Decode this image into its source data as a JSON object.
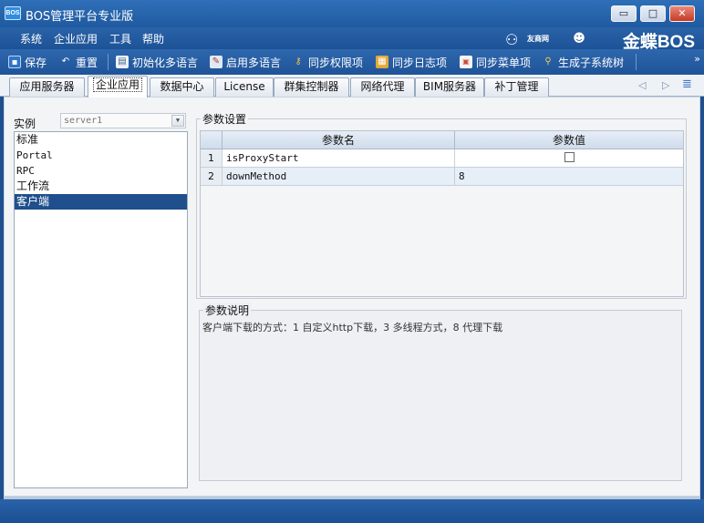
{
  "window": {
    "app_icon_text": "BOS",
    "title": "BOS管理平台专业版",
    "controls": {
      "minimize": "▭",
      "maximize": "□",
      "close": "✕"
    }
  },
  "menu": [
    "系统",
    "企业应用",
    "工具",
    "帮助"
  ],
  "brand": {
    "yy_text": "友商网",
    "kd_text": "金蝶BOS"
  },
  "toolbar": [
    {
      "label": "保存",
      "icon": "save-icon",
      "color": "#2f74c9"
    },
    {
      "label": "重置",
      "icon": "reset-icon",
      "color": "#6aa0de"
    },
    {
      "label": "初始化多语言",
      "icon": "document-icon",
      "color": "#e9eef6"
    },
    {
      "label": "启用多语言",
      "icon": "edit-icon",
      "color": "#7ba7d8"
    },
    {
      "label": "同步权限项",
      "icon": "key-icon",
      "color": "#e8b640"
    },
    {
      "label": "同步日志项",
      "icon": "log-icon",
      "color": "#d9a23a"
    },
    {
      "label": "同步菜单项",
      "icon": "menu-icon",
      "color": "#c94b3b"
    },
    {
      "label": "生成子系统树",
      "icon": "tree-icon",
      "color": "#e6c448"
    }
  ],
  "tabs": [
    "应用服务器",
    "企业应用",
    "数据中心",
    "License",
    "群集控制器",
    "网络代理",
    "BIM服务器",
    "补丁管理"
  ],
  "active_tab_index": 1,
  "instance": {
    "label": "实例",
    "selected": "server1"
  },
  "instance_list": [
    "标准",
    "Portal",
    "RPC",
    "工作流",
    "客户端"
  ],
  "selected_list_index": 4,
  "params": {
    "legend": "参数设置",
    "col_name": "参数名",
    "col_value": "参数值",
    "rows": [
      {
        "num": "1",
        "name": "isProxyStart",
        "value": "",
        "checkbox": true
      },
      {
        "num": "2",
        "name": "downMethod",
        "value": "8",
        "checkbox": false
      }
    ]
  },
  "description": {
    "legend": "参数说明",
    "text": "客户端下载的方式：1 自定义http下载，3 多线程方式，8 代理下载"
  }
}
